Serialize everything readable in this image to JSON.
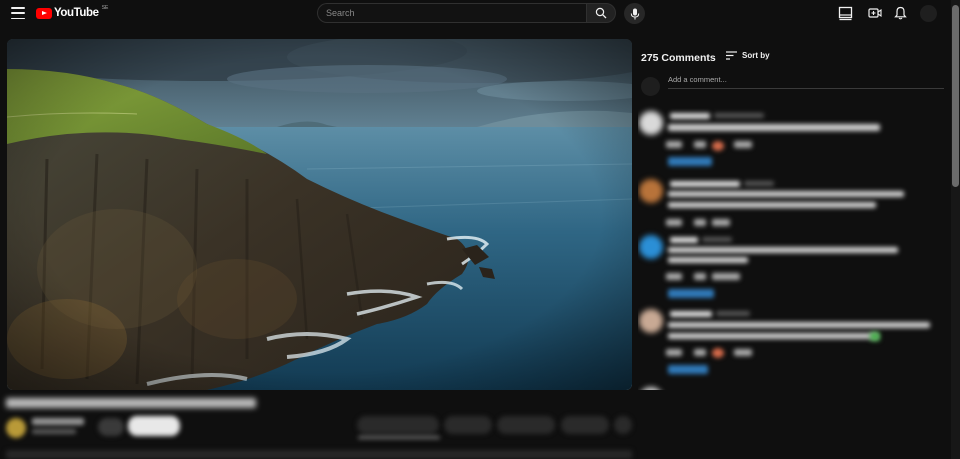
{
  "header": {
    "logo_text": "YouTube",
    "logo_sup": "SE",
    "search_placeholder": "Search",
    "icons": [
      "menu-icon",
      "search-icon",
      "mic-icon",
      "theater-icon",
      "create-icon",
      "bell-icon"
    ]
  },
  "player": {
    "scene": "coastal cliffs and ocean"
  },
  "comments": {
    "count_label": "275 Comments",
    "sort_label": "Sort by",
    "add_placeholder": "Add a comment..."
  },
  "colors": {
    "background": "#0f0f0f",
    "brand_red": "#ff0000",
    "link_blue": "#3ea6ff"
  }
}
